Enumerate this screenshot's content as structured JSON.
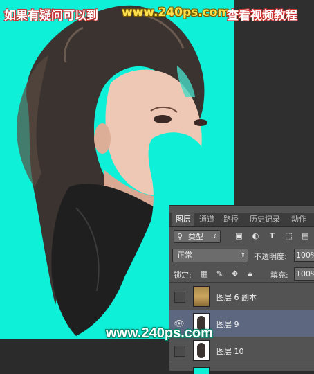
{
  "header": {
    "left": "如果有疑问可以到",
    "mid": "www.240ps.com",
    "right": "查看视频教程"
  },
  "watermark": "www.240ps.com",
  "colors": {
    "canvas_bg": "#0ff0d8",
    "panel_bg": "#535353",
    "selected_layer": "#5d6880"
  },
  "panel": {
    "tabs": [
      {
        "label": "图层",
        "active": true
      },
      {
        "label": "通道",
        "active": false
      },
      {
        "label": "路径",
        "active": false
      },
      {
        "label": "历史记录",
        "active": false
      },
      {
        "label": "动作",
        "active": false
      }
    ],
    "filter": {
      "kind_label": "类型",
      "icons": [
        "image-filter-icon",
        "adjustment-filter-icon",
        "type-filter-icon",
        "shape-filter-icon",
        "smart-object-filter-icon"
      ]
    },
    "blend_mode": "正常",
    "opacity_label": "不透明度:",
    "opacity_value": "100%",
    "lock_label": "锁定:",
    "fill_label": "填充:",
    "fill_value": "100%",
    "layers": [
      {
        "name": "图层 6 副本",
        "visible": false,
        "selected": false
      },
      {
        "name": "图层 9",
        "visible": true,
        "selected": true
      },
      {
        "name": "图层 10",
        "visible": false,
        "selected": false
      }
    ]
  }
}
